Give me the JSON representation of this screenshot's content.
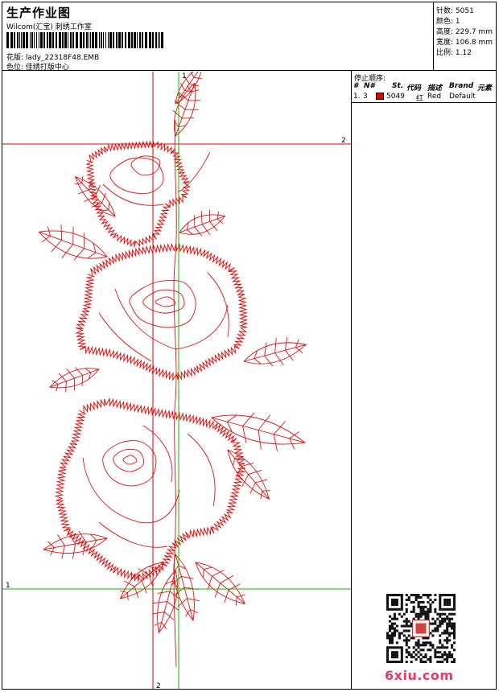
{
  "header": {
    "title": "生产作业图",
    "company": "Wilcom(汇宝) 刺绣工作室",
    "design_label": "花版:",
    "design_file": "lady_22318F48.EMB",
    "color_label": "色位:",
    "color_value": "佳绣打版中心"
  },
  "stats": {
    "stitches": "针数: 5051",
    "colors": "颜色: 1",
    "height": "高度: 229.7 mm",
    "width": "宽度: 106.8 mm",
    "scale": "比例: 1.12"
  },
  "sequence": {
    "title": "停止顺序:",
    "columns": [
      "#",
      "N#",
      "St.",
      "代码",
      "描述",
      "Brand",
      "元素"
    ],
    "rows": [
      {
        "index": "1.",
        "needle": "3",
        "stitches": "5049",
        "code": "红",
        "desc": "Red",
        "brand": "Default",
        "color": "#e00000"
      }
    ]
  },
  "guides": {
    "h_top": "2",
    "h_bottom": "1",
    "v_top": "1",
    "v_bottom": "2"
  },
  "watermark": "6xiu.com",
  "colors": {
    "thread": "#e31010",
    "guide_red": "#e00000",
    "guide_green": "#00c000"
  }
}
